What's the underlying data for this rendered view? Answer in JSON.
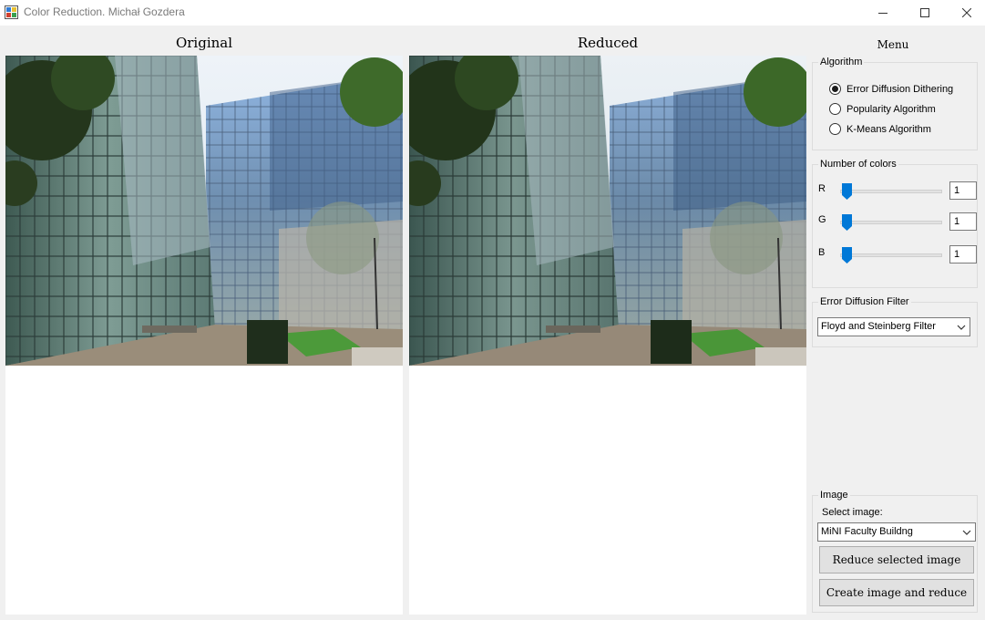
{
  "window": {
    "title": "Color Reduction. Michał Gozdera"
  },
  "panels": {
    "original_title": "Original",
    "reduced_title": "Reduced"
  },
  "menu": {
    "title": "Menu",
    "algorithm": {
      "title": "Algorithm",
      "options": [
        "Error Diffusion Dithering",
        "Popularity Algorithm",
        "K-Means Algorithm"
      ],
      "selected": "Error Diffusion Dithering"
    },
    "colors": {
      "title": "Number of colors",
      "channels": [
        {
          "label": "R",
          "value": "1"
        },
        {
          "label": "G",
          "value": "1"
        },
        {
          "label": "B",
          "value": "1"
        }
      ]
    },
    "filter": {
      "title": "Error Diffusion Filter",
      "selected": "Floyd and Steinberg Filter"
    },
    "image": {
      "title": "Image",
      "select_label": "Select image:",
      "selected": "MiNI Faculty Buildng",
      "reduce_button": "Reduce selected image",
      "create_button": "Create image and reduce"
    }
  },
  "colors": {
    "accent": "#0078d7",
    "window_bg": "#f0f0f0"
  }
}
